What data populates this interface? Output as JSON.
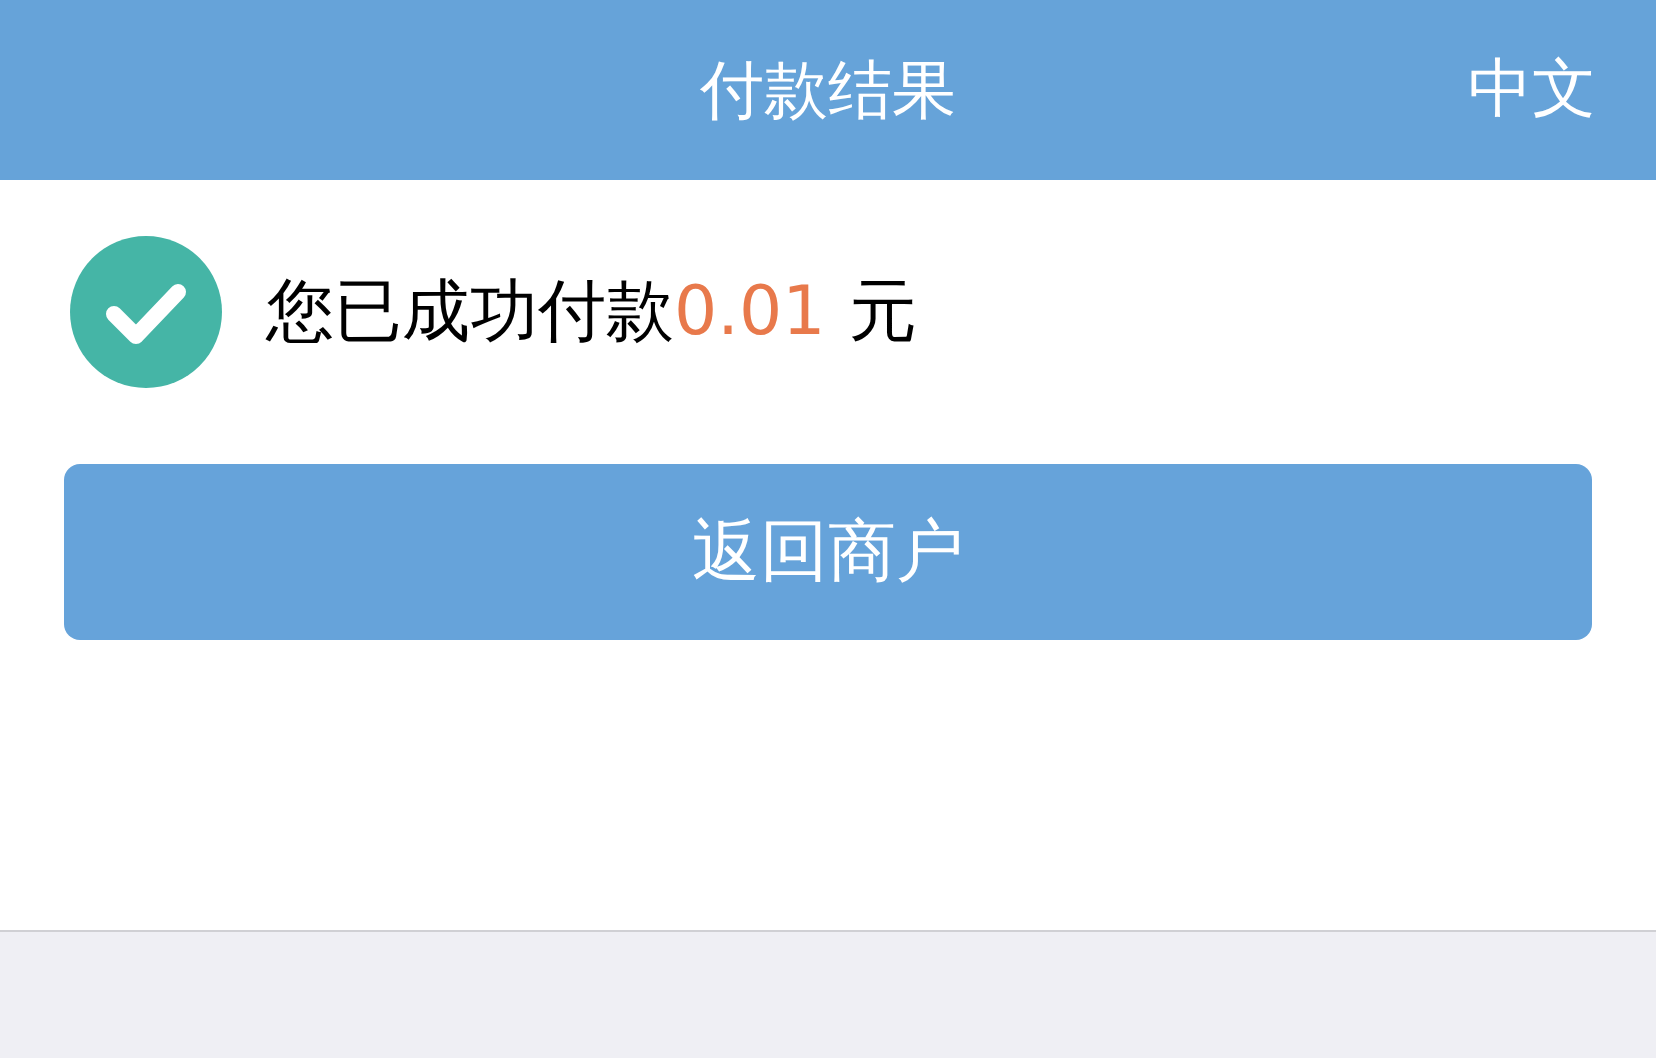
{
  "header": {
    "title": "付款结果",
    "language": "中文"
  },
  "result": {
    "success": true,
    "message": "您已成功付款",
    "amount": "0.01",
    "currency": "元"
  },
  "button": {
    "label": "返回商户"
  }
}
